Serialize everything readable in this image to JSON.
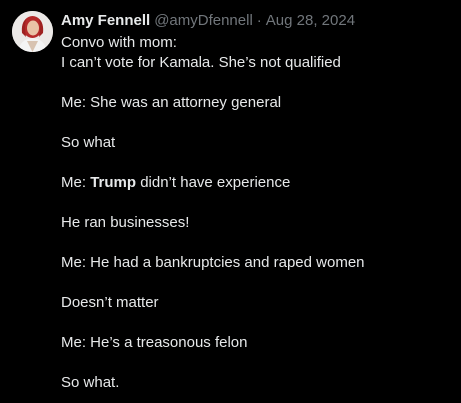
{
  "author": {
    "display_name": "Amy Fennell",
    "handle": "@amyDfennell",
    "separator": "·",
    "date": "Aug 28, 2024"
  },
  "tweet": {
    "line1": "Convo with mom:",
    "line2": "I can’t vote for Kamala. She’s not qualified",
    "line3": "Me: She was an attorney general",
    "line4": "So what",
    "line5_prefix": "Me: ",
    "line5_bold": "Trump",
    "line5_suffix": " didn’t have experience",
    "line6": "He ran businesses!",
    "line7": "Me: He had a bankruptcies and raped women",
    "line8": "Doesn’t matter",
    "line9": "Me: He’s a treasonous felon",
    "line10": "So what."
  },
  "colors": {
    "background": "#000000",
    "text": "#e7e9ea",
    "secondary_text": "#71767b"
  }
}
